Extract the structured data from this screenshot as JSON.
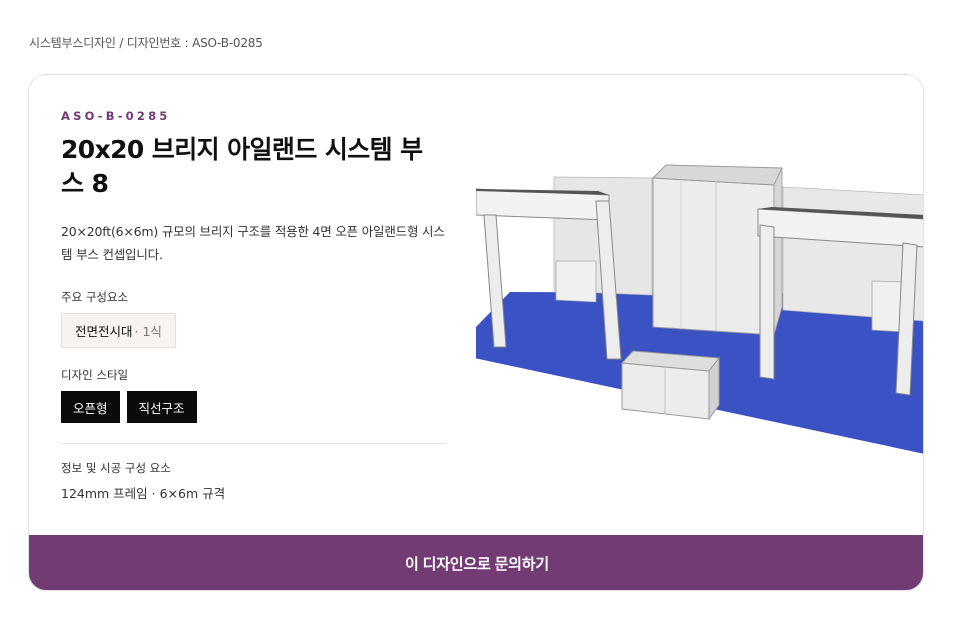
{
  "breadcrumb": "시스템부스디자인 / 디자인번호 : ASO-B-0285",
  "design": {
    "code": "ASO-B-0285",
    "title": "20x20 브리지 아일랜드 시스템 부스 8",
    "description": "20×20ft(6×6m) 규모의 브리지 구조를 적용한 4면 오픈 아일랜드형 시스템 부스 컨셉입니다."
  },
  "components": {
    "label": "주요 구성요소",
    "items": [
      {
        "name": "전면전시대",
        "qty": "· 1식"
      }
    ]
  },
  "style": {
    "label": "디자인 스타일",
    "tags": [
      "오픈형",
      "직선구조"
    ]
  },
  "info": {
    "label": "정보 및 시공 구성 요소",
    "text": "124mm 프레임 · 6×6m 규격"
  },
  "cta": {
    "label": "이 디자인으로 문의하기"
  },
  "colors": {
    "accent": "#723b73",
    "floor": "#3b52c4",
    "tag_bg": "#0b0b0b"
  }
}
